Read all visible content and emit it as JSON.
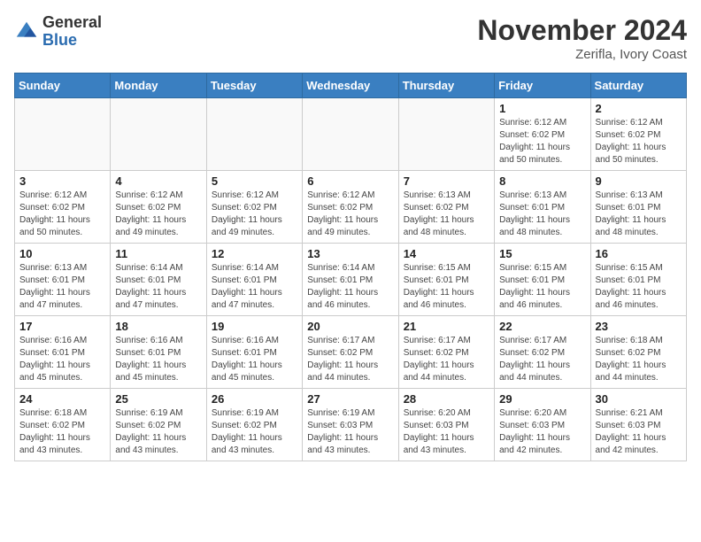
{
  "header": {
    "logo_general": "General",
    "logo_blue": "Blue",
    "month": "November 2024",
    "location": "Zerifla, Ivory Coast"
  },
  "days_of_week": [
    "Sunday",
    "Monday",
    "Tuesday",
    "Wednesday",
    "Thursday",
    "Friday",
    "Saturday"
  ],
  "weeks": [
    [
      {
        "day": "",
        "info": ""
      },
      {
        "day": "",
        "info": ""
      },
      {
        "day": "",
        "info": ""
      },
      {
        "day": "",
        "info": ""
      },
      {
        "day": "",
        "info": ""
      },
      {
        "day": "1",
        "info": "Sunrise: 6:12 AM\nSunset: 6:02 PM\nDaylight: 11 hours\nand 50 minutes."
      },
      {
        "day": "2",
        "info": "Sunrise: 6:12 AM\nSunset: 6:02 PM\nDaylight: 11 hours\nand 50 minutes."
      }
    ],
    [
      {
        "day": "3",
        "info": "Sunrise: 6:12 AM\nSunset: 6:02 PM\nDaylight: 11 hours\nand 50 minutes."
      },
      {
        "day": "4",
        "info": "Sunrise: 6:12 AM\nSunset: 6:02 PM\nDaylight: 11 hours\nand 49 minutes."
      },
      {
        "day": "5",
        "info": "Sunrise: 6:12 AM\nSunset: 6:02 PM\nDaylight: 11 hours\nand 49 minutes."
      },
      {
        "day": "6",
        "info": "Sunrise: 6:12 AM\nSunset: 6:02 PM\nDaylight: 11 hours\nand 49 minutes."
      },
      {
        "day": "7",
        "info": "Sunrise: 6:13 AM\nSunset: 6:02 PM\nDaylight: 11 hours\nand 48 minutes."
      },
      {
        "day": "8",
        "info": "Sunrise: 6:13 AM\nSunset: 6:01 PM\nDaylight: 11 hours\nand 48 minutes."
      },
      {
        "day": "9",
        "info": "Sunrise: 6:13 AM\nSunset: 6:01 PM\nDaylight: 11 hours\nand 48 minutes."
      }
    ],
    [
      {
        "day": "10",
        "info": "Sunrise: 6:13 AM\nSunset: 6:01 PM\nDaylight: 11 hours\nand 47 minutes."
      },
      {
        "day": "11",
        "info": "Sunrise: 6:14 AM\nSunset: 6:01 PM\nDaylight: 11 hours\nand 47 minutes."
      },
      {
        "day": "12",
        "info": "Sunrise: 6:14 AM\nSunset: 6:01 PM\nDaylight: 11 hours\nand 47 minutes."
      },
      {
        "day": "13",
        "info": "Sunrise: 6:14 AM\nSunset: 6:01 PM\nDaylight: 11 hours\nand 46 minutes."
      },
      {
        "day": "14",
        "info": "Sunrise: 6:15 AM\nSunset: 6:01 PM\nDaylight: 11 hours\nand 46 minutes."
      },
      {
        "day": "15",
        "info": "Sunrise: 6:15 AM\nSunset: 6:01 PM\nDaylight: 11 hours\nand 46 minutes."
      },
      {
        "day": "16",
        "info": "Sunrise: 6:15 AM\nSunset: 6:01 PM\nDaylight: 11 hours\nand 46 minutes."
      }
    ],
    [
      {
        "day": "17",
        "info": "Sunrise: 6:16 AM\nSunset: 6:01 PM\nDaylight: 11 hours\nand 45 minutes."
      },
      {
        "day": "18",
        "info": "Sunrise: 6:16 AM\nSunset: 6:01 PM\nDaylight: 11 hours\nand 45 minutes."
      },
      {
        "day": "19",
        "info": "Sunrise: 6:16 AM\nSunset: 6:01 PM\nDaylight: 11 hours\nand 45 minutes."
      },
      {
        "day": "20",
        "info": "Sunrise: 6:17 AM\nSunset: 6:02 PM\nDaylight: 11 hours\nand 44 minutes."
      },
      {
        "day": "21",
        "info": "Sunrise: 6:17 AM\nSunset: 6:02 PM\nDaylight: 11 hours\nand 44 minutes."
      },
      {
        "day": "22",
        "info": "Sunrise: 6:17 AM\nSunset: 6:02 PM\nDaylight: 11 hours\nand 44 minutes."
      },
      {
        "day": "23",
        "info": "Sunrise: 6:18 AM\nSunset: 6:02 PM\nDaylight: 11 hours\nand 44 minutes."
      }
    ],
    [
      {
        "day": "24",
        "info": "Sunrise: 6:18 AM\nSunset: 6:02 PM\nDaylight: 11 hours\nand 43 minutes."
      },
      {
        "day": "25",
        "info": "Sunrise: 6:19 AM\nSunset: 6:02 PM\nDaylight: 11 hours\nand 43 minutes."
      },
      {
        "day": "26",
        "info": "Sunrise: 6:19 AM\nSunset: 6:02 PM\nDaylight: 11 hours\nand 43 minutes."
      },
      {
        "day": "27",
        "info": "Sunrise: 6:19 AM\nSunset: 6:03 PM\nDaylight: 11 hours\nand 43 minutes."
      },
      {
        "day": "28",
        "info": "Sunrise: 6:20 AM\nSunset: 6:03 PM\nDaylight: 11 hours\nand 43 minutes."
      },
      {
        "day": "29",
        "info": "Sunrise: 6:20 AM\nSunset: 6:03 PM\nDaylight: 11 hours\nand 42 minutes."
      },
      {
        "day": "30",
        "info": "Sunrise: 6:21 AM\nSunset: 6:03 PM\nDaylight: 11 hours\nand 42 minutes."
      }
    ]
  ]
}
